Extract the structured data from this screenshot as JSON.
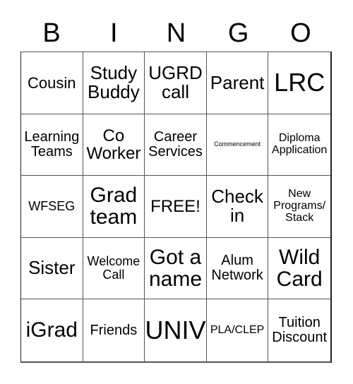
{
  "header": [
    "B",
    "I",
    "N",
    "G",
    "O"
  ],
  "cells": [
    "Cousin",
    "Study\nBuddy",
    "UGRD\ncall",
    "Parent",
    "LRC",
    "Learning\nTeams",
    "Co\nWorker",
    "Career\nServices",
    "Commencement",
    "Diploma\nApplication",
    "WFSEG",
    "Grad\nteam",
    "FREE!",
    "Check\nin",
    "New\nPrograms/\nStack",
    "Sister",
    "Welcome\nCall",
    "Got a\nname",
    "Alum\nNetwork",
    "Wild\nCard",
    "iGrad",
    "Friends",
    "UNIV",
    "PLA/CLEP",
    "Tuition\nDiscount"
  ]
}
